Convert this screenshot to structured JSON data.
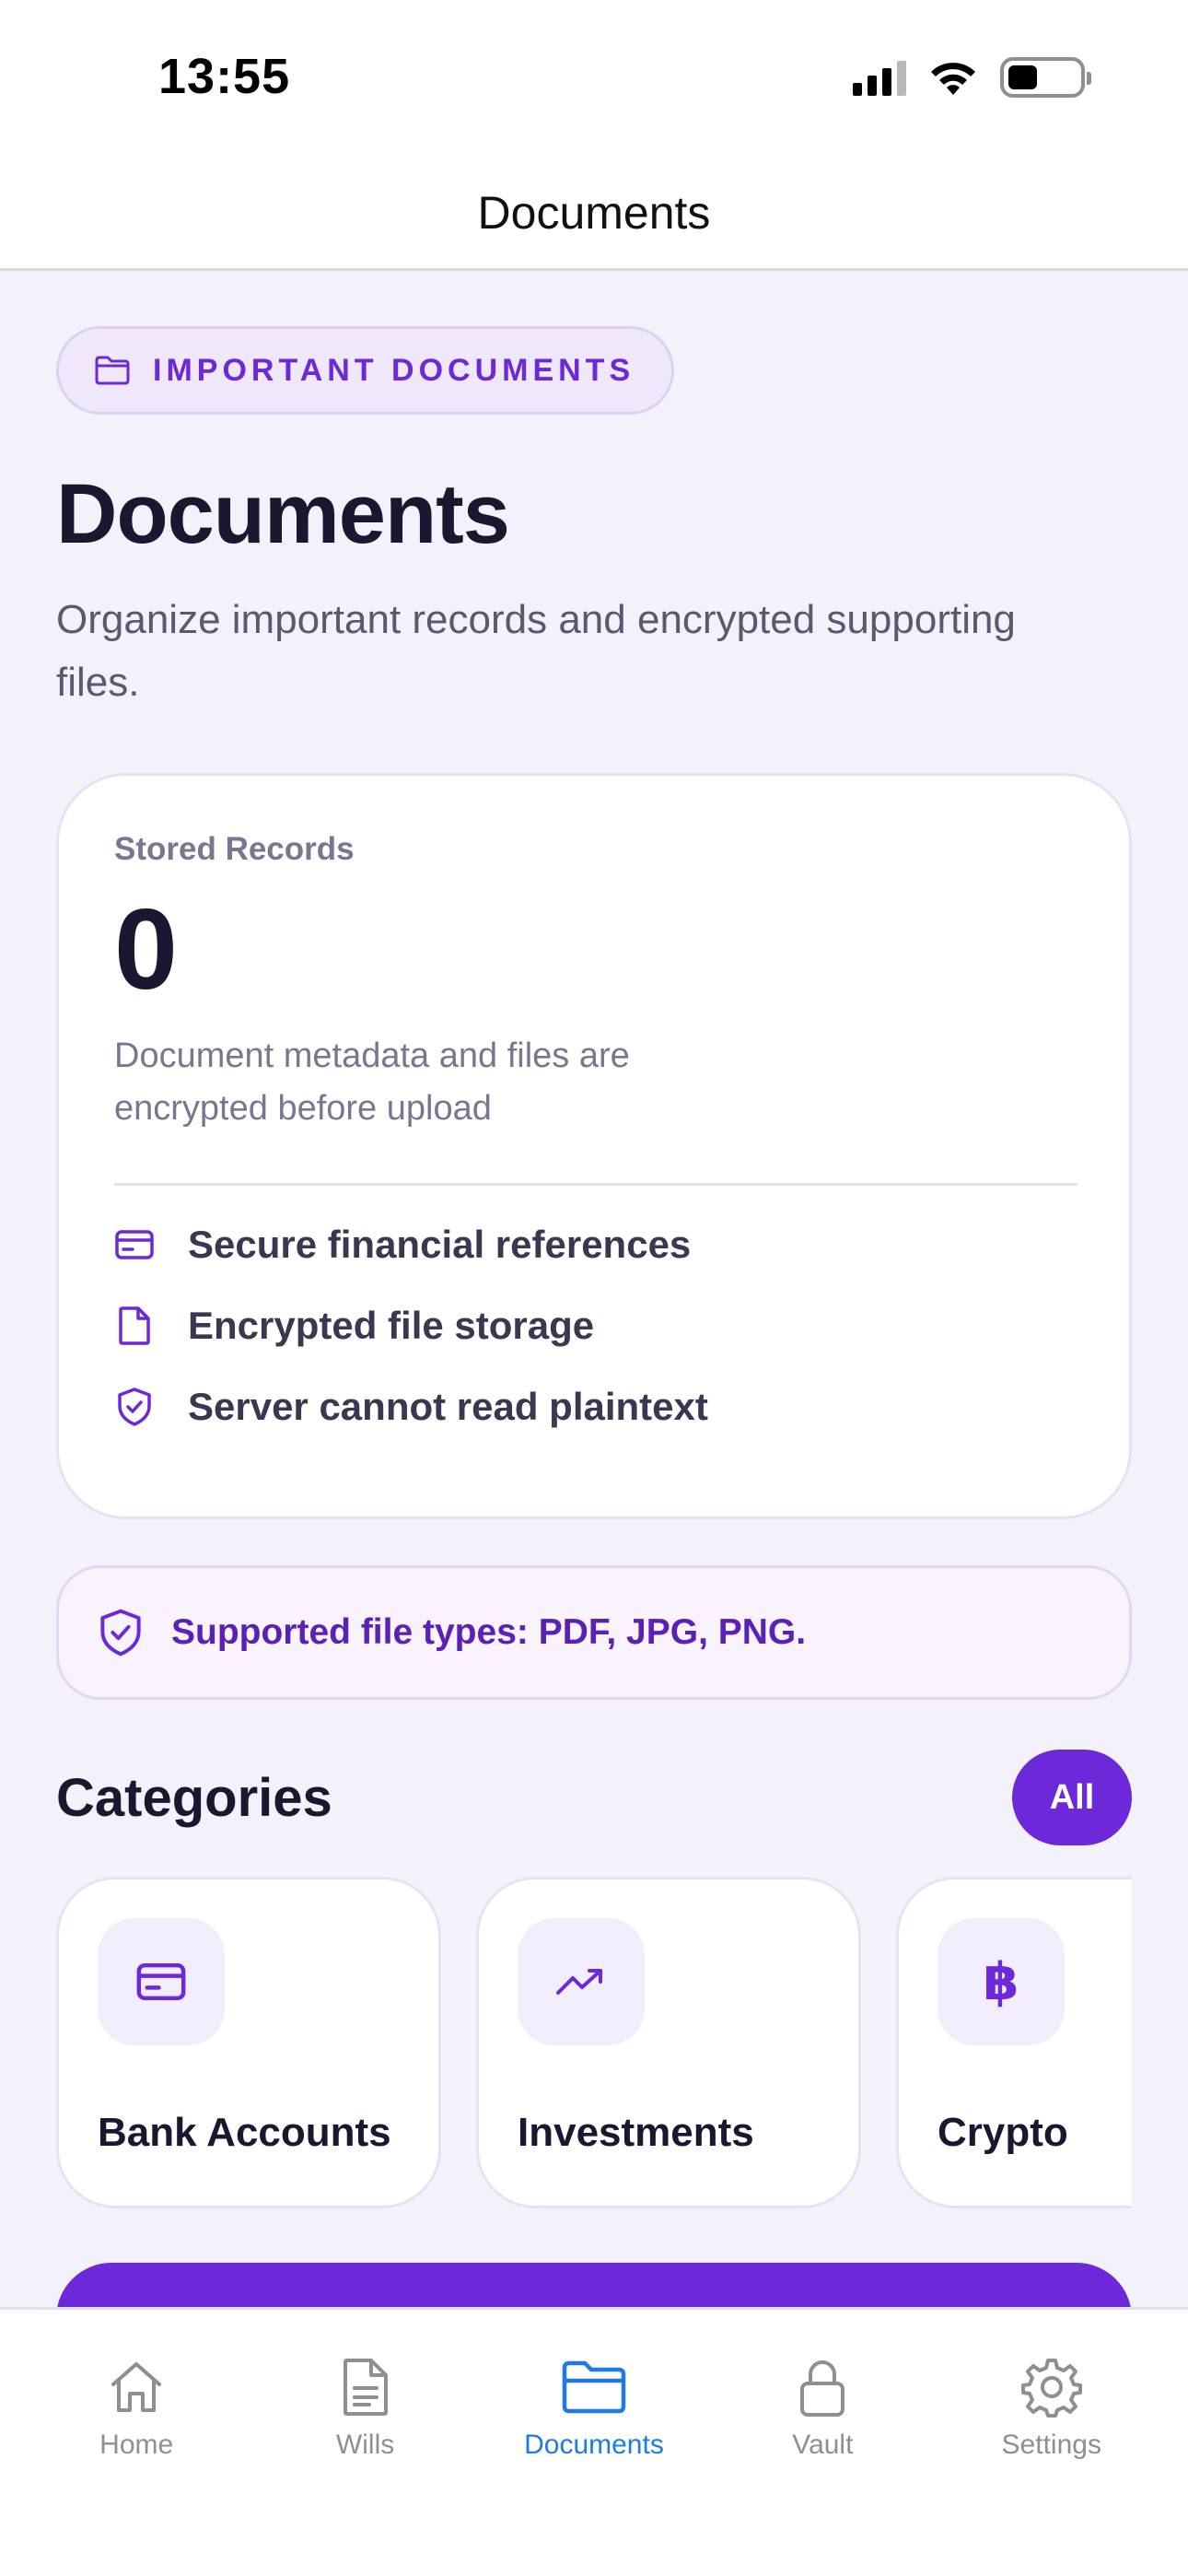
{
  "status_bar": {
    "time": "13:55",
    "icons": [
      "signal-icon",
      "wifi-icon",
      "battery-icon"
    ]
  },
  "nav": {
    "title": "Documents"
  },
  "header": {
    "badge_label": "IMPORTANT DOCUMENTS",
    "badge_icon": "folder-icon",
    "title": "Documents",
    "subtitle": "Organize important records and encrypted supporting files."
  },
  "stats_card": {
    "label": "Stored Records",
    "value": "0",
    "description": "Document metadata and files are encrypted before upload",
    "features": [
      {
        "icon": "credit-card-icon",
        "label": "Secure financial references"
      },
      {
        "icon": "file-icon",
        "label": "Encrypted file storage"
      },
      {
        "icon": "shield-check-icon",
        "label": "Server cannot read plaintext"
      }
    ]
  },
  "notice": {
    "icon": "shield-check-icon",
    "text": "Supported file types: PDF, JPG, PNG."
  },
  "categories": {
    "title": "Categories",
    "filter_label": "All",
    "items": [
      {
        "icon": "credit-card-icon",
        "label": "Bank Accounts"
      },
      {
        "icon": "trending-up-icon",
        "label": "Investments"
      },
      {
        "icon": "bitcoin-icon",
        "label": "Crypto"
      }
    ]
  },
  "tab_bar": {
    "tabs": [
      {
        "icon": "home-icon",
        "label": "Home",
        "active": false
      },
      {
        "icon": "document-icon",
        "label": "Wills",
        "active": false
      },
      {
        "icon": "folder-icon",
        "label": "Documents",
        "active": true
      },
      {
        "icon": "lock-icon",
        "label": "Vault",
        "active": false
      },
      {
        "icon": "gear-icon",
        "label": "Settings",
        "active": false
      }
    ]
  },
  "colors": {
    "accent": "#6d28d9",
    "tab_active": "#1d7ae6",
    "background": "#f3f2fa"
  }
}
